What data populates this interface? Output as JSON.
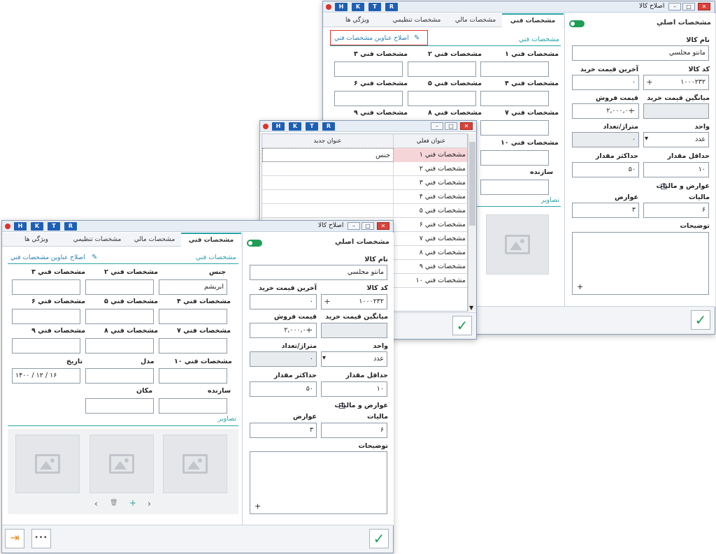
{
  "titlebar_keys": [
    "H",
    "K",
    "T",
    "R"
  ],
  "win_title": "اصلاح کالا",
  "tabs": {
    "technical": "مشخصات فني",
    "financial": "مشخصات مالي",
    "settings": "مشخصات تنظيمي",
    "features": "ويژگي ها"
  },
  "main_section": {
    "title": "مشخصات اصلي",
    "name_label": "نام کالا",
    "name_value": "مانتو مجلسي",
    "code_label": "کد کالا",
    "code_value": "۱۰۰۰۲۳۲",
    "last_price_label": "آخرين قيمت خريد",
    "last_price_value": "۰",
    "avg_price_label": "ميانگين قيمت خريد",
    "sale_price_label": "قيمت فروش",
    "sale_price_value": "۲,۰۰۰,۰۰۰",
    "unit_label": "واحد",
    "unit_value": "عدد",
    "meter_label": "متراژ/تعداد",
    "meter_value": "۰",
    "min_label": "حداقل مقدار",
    "min_value": "۱۰",
    "max_label": "حداکثر مقدار",
    "max_value": "۵۰",
    "tax_check_label": "عوارض و ماليات",
    "tax_label": "ماليات",
    "tax_value": "۶",
    "duty_label": "عوارض",
    "duty_value": "۳",
    "desc_label": "توضيحات",
    "add_symbol": "+"
  },
  "tech_section": {
    "title": "مشخصات فني",
    "edit_titles_link": "اصلاح عناوين مشخصات فني",
    "fields": [
      "مشخصات فني ۱",
      "مشخصات فني ۲",
      "مشخصات فني ۳",
      "مشخصات فني ۴",
      "مشخصات فني ۵",
      "مشخصات فني ۶",
      "مشخصات فني ۷",
      "مشخصات فني ۸",
      "مشخصات فني ۹",
      "مشخصات فني ۱۰"
    ],
    "manufacturer_label": "سازنده",
    "images_label": "تصاوير"
  },
  "front_tech": {
    "field1_label": "جنس",
    "field1_value": "ابريشم",
    "model_label": "مدل",
    "date_label": "تاريخ",
    "date_value": "۱۴۰۰ / ۱۲ / ۱۶",
    "place_label": "مکان"
  },
  "rename_dialog": {
    "col_current": "عنوان فعلي",
    "col_new": "عنوان جديد",
    "rows": [
      {
        "current": "مشخصات فني ۱",
        "new": "جنس"
      },
      {
        "current": "مشخصات فني ۲",
        "new": ""
      },
      {
        "current": "مشخصات فني ۳",
        "new": ""
      },
      {
        "current": "مشخصات فني ۴",
        "new": ""
      },
      {
        "current": "مشخصات فني ۵",
        "new": ""
      },
      {
        "current": "مشخصات فني ۶",
        "new": ""
      },
      {
        "current": "مشخصات فني ۷",
        "new": ""
      },
      {
        "current": "مشخصات فني ۸",
        "new": ""
      },
      {
        "current": "مشخصات فني ۹",
        "new": ""
      },
      {
        "current": "مشخصات فني ۱۰",
        "new": ""
      }
    ]
  },
  "icons": {
    "ok": "✓",
    "more": "•••",
    "exit": "⇥",
    "prev": "‹",
    "next": "›",
    "trash": "🗑",
    "add": "+",
    "pencil": "✎",
    "dropdown": "▾",
    "check": "✓"
  },
  "colors": {
    "accent": "#2aa3a8",
    "key_blue": "#1e5fb4",
    "ok_green": "#1f9d54",
    "highlight_pink": "#f6d5d8",
    "red_frame": "#e0312a"
  }
}
